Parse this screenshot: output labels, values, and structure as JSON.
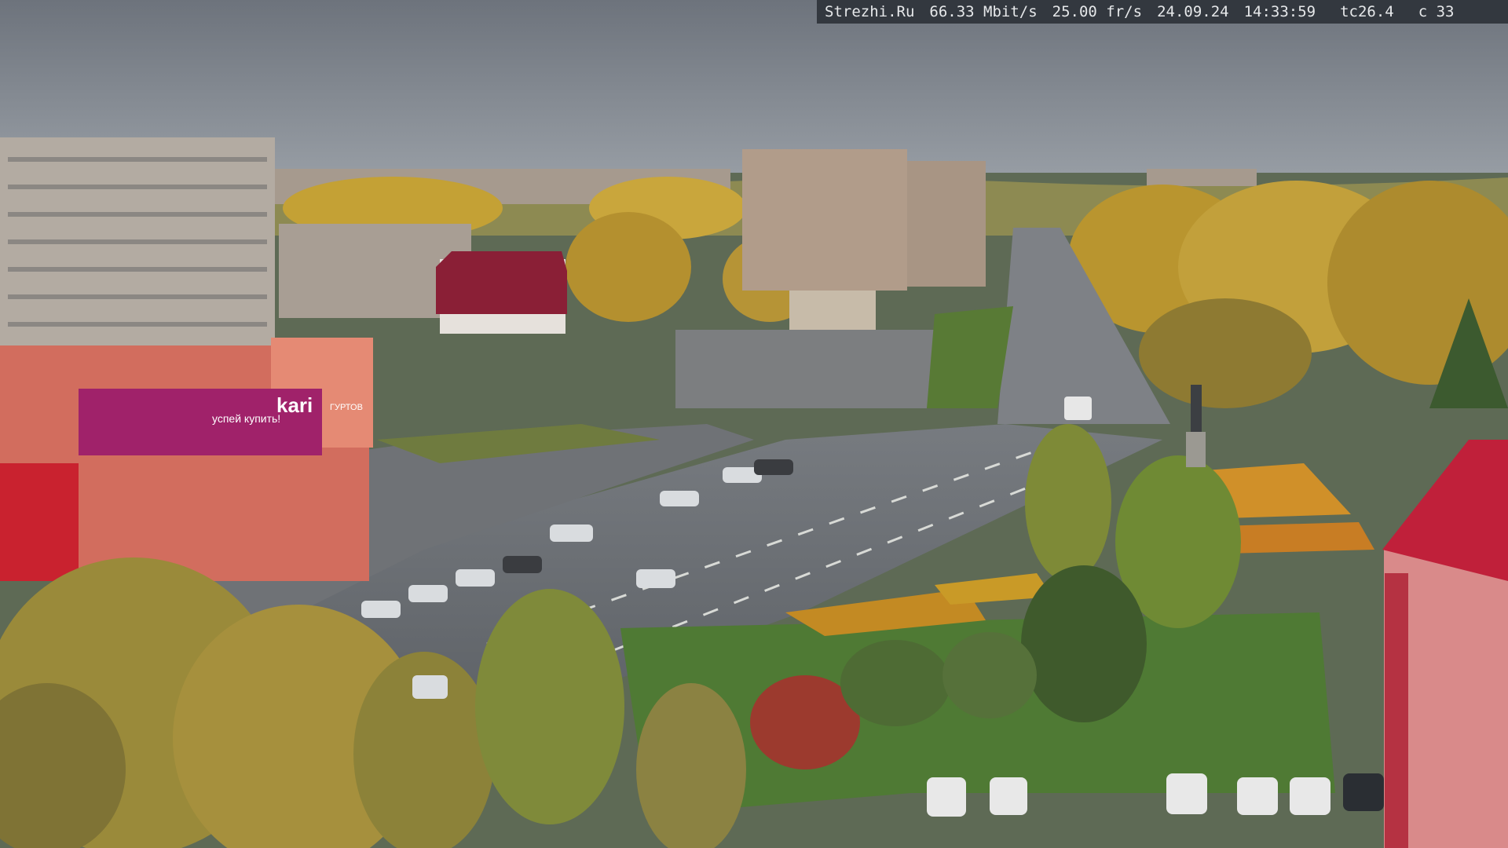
{
  "osd": {
    "site": "Strezhi.Ru",
    "bitrate": "66.33 Mbit/s",
    "framerate": "25.00 fr/s",
    "date": "24.09.24",
    "time": "14:33:59",
    "temp": "tc26.4",
    "cam": "c 33"
  },
  "storefront": {
    "brand": "kari",
    "brand_slogan": "успей купить!",
    "sign": "ГУРТОВ"
  },
  "colors": {
    "sky": "#7a8089",
    "foliage_gold": "#c9a43a",
    "storefront_magenta": "#a0226a",
    "brick_red": "#c0203a"
  }
}
